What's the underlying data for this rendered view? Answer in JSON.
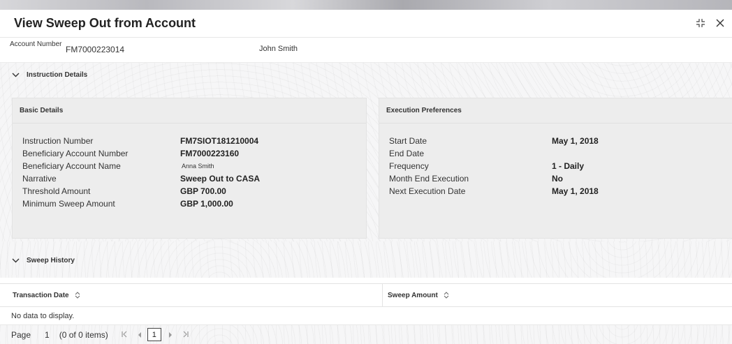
{
  "window": {
    "title": "View Sweep Out from Account"
  },
  "account": {
    "label": "Account Number",
    "number": "FM7000223014",
    "name": "John Smith"
  },
  "instruction_details": {
    "title": "Instruction Details",
    "basic": {
      "title": "Basic Details",
      "rows": [
        {
          "label": "Instruction Number",
          "value": "FM7SIOT181210004"
        },
        {
          "label": "Beneficiary Account Number",
          "value": "FM7000223160"
        },
        {
          "label": "Beneficiary Account Name",
          "value": "Anna Smith"
        },
        {
          "label": "Narrative",
          "value": "Sweep Out to CASA"
        },
        {
          "label": "Threshold Amount",
          "value": "GBP 700.00"
        },
        {
          "label": "Minimum Sweep Amount",
          "value": "GBP 1,000.00"
        }
      ]
    },
    "execution": {
      "title": "Execution Preferences",
      "rows": [
        {
          "label": "Start Date",
          "value": "May 1, 2018"
        },
        {
          "label": "End Date",
          "value": ""
        },
        {
          "label": "Frequency",
          "value": "1 - Daily"
        },
        {
          "label": "Month End Execution",
          "value": "No"
        },
        {
          "label": "Next Execution Date",
          "value": "May 1, 2018"
        }
      ]
    }
  },
  "sweep_history": {
    "title": "Sweep History",
    "columns": [
      "Transaction Date",
      "Sweep Amount"
    ],
    "empty_text": "No data to display."
  },
  "pager": {
    "page_label": "Page",
    "page_number": "1",
    "items_text": "(0 of 0 items)",
    "current": "1"
  },
  "icons": {
    "expand": "expand-icon",
    "close": "close-icon",
    "chevron": "chevron-down-icon",
    "sort": "sort-icon"
  }
}
